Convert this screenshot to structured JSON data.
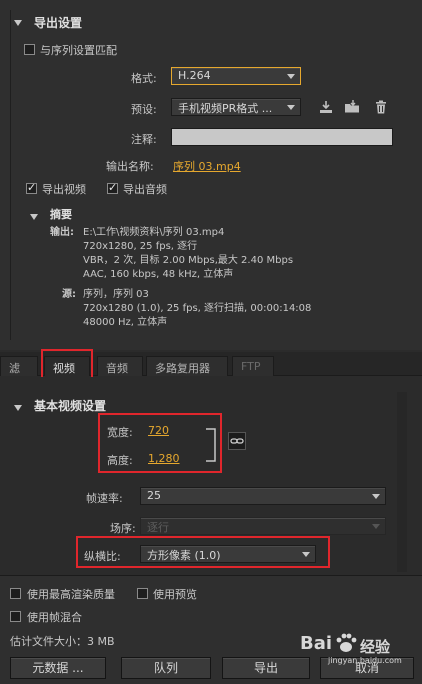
{
  "export_settings": {
    "title": "导出设置",
    "match_sequence": "与序列设置匹配",
    "format_label": "格式:",
    "format_value": "H.264",
    "preset_label": "预设:",
    "preset_value": "手机视频PR格式 ...",
    "comment_label": "注释:",
    "comment_value": "",
    "output_name_label": "输出名称:",
    "output_name_value": "序列 03.mp4",
    "export_video": "导出视频",
    "export_audio": "导出音频"
  },
  "summary": {
    "title": "摘要",
    "output_label": "输出:",
    "output_lines": [
      "E:\\工作\\视频资料\\序列 03.mp4",
      "720x1280, 25 fps, 逐行",
      "VBR，2 次, 目标 2.00 Mbps,最大 2.40 Mbps",
      "AAC, 160 kbps, 48 kHz, 立体声"
    ],
    "source_label": "源:",
    "source_lines": [
      "序列，序列 03",
      "720x1280 (1.0), 25 fps, 逐行扫描, 00:00:14:08",
      "48000 Hz, 立体声"
    ]
  },
  "tabs": [
    {
      "label": "滤镜"
    },
    {
      "label": "视频"
    },
    {
      "label": "音频"
    },
    {
      "label": "多路复用器"
    },
    {
      "label": "FTP"
    }
  ],
  "video": {
    "section_title": "基本视频设置",
    "width_label": "宽度:",
    "width_value": "720",
    "height_label": "高度:",
    "height_value": "1,280",
    "framerate_label": "帧速率:",
    "framerate_value": "25",
    "field_order_label": "场序:",
    "field_order_value": "逐行",
    "aspect_label": "纵横比:",
    "aspect_value": "方形像素 (1.0)"
  },
  "bottom": {
    "max_quality": "使用最高渲染质量",
    "use_preview": "使用预览",
    "frame_blend": "使用帧混合",
    "file_size": "估计文件大小：3 MB",
    "metadata_btn": "元数据 ...",
    "queue_btn": "队列",
    "export_btn": "导出",
    "cancel_btn": "取消"
  },
  "watermark": {
    "brand": "Bai",
    "brand2": "经验",
    "url": "jingyan.baidu.com"
  }
}
